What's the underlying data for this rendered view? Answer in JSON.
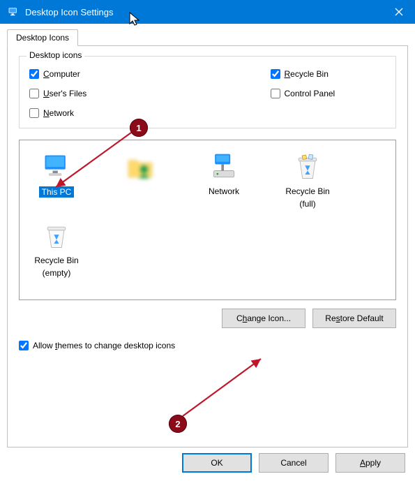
{
  "window": {
    "title": "Desktop Icon Settings"
  },
  "tab": {
    "label": "Desktop Icons"
  },
  "group": {
    "legend": "Desktop icons"
  },
  "checkboxes": {
    "computer": {
      "label_pre": "C",
      "label_rest": "omputer",
      "checked": true
    },
    "users_files": {
      "label_pre": "U",
      "label_rest": "ser's Files",
      "checked": false
    },
    "network": {
      "label_pre": "N",
      "label_rest": "etwork",
      "checked": false
    },
    "recycle_bin": {
      "label_pre": "R",
      "label_rest": "ecycle Bin",
      "checked": true
    },
    "control_panel": {
      "label_pre": "",
      "label_rest": "Control Panel",
      "checked": false
    }
  },
  "icons": {
    "this_pc": "This PC",
    "blurred": "       ",
    "network": "Network",
    "recycle_full_line1": "Recycle Bin",
    "recycle_full_line2": "(full)",
    "recycle_empty_line1": "Recycle Bin",
    "recycle_empty_line2": "(empty)"
  },
  "buttons": {
    "change_icon": {
      "pre": "C",
      "u": "h",
      "rest": "ange Icon..."
    },
    "restore_default": {
      "pre": "Re",
      "u": "s",
      "rest": "tore Default"
    },
    "ok": "OK",
    "cancel": "Cancel",
    "apply": {
      "u": "A",
      "rest": "pply"
    }
  },
  "allow_themes": {
    "pre": "Allow ",
    "u": "t",
    "rest": "hemes to change desktop icons",
    "checked": true
  },
  "annotations": {
    "badge1": "1",
    "badge2": "2"
  }
}
